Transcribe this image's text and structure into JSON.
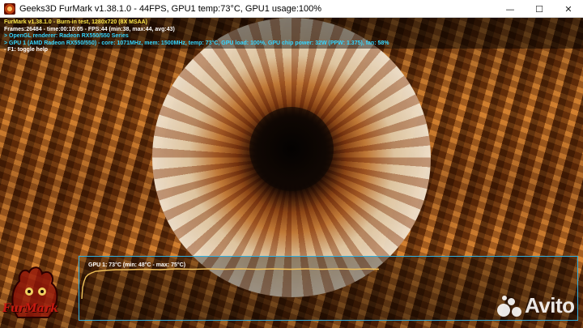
{
  "window": {
    "title": "Geeks3D FurMark v1.38.1.0 - 44FPS, GPU1 temp:73°C, GPU1 usage:100%",
    "app_icon": "furmark-app-icon",
    "controls": {
      "minimize": "—",
      "maximize": "☐",
      "close": "✕"
    }
  },
  "osd": {
    "line1": "FurMark v1.38.1.0 - Burn-in test, 1280x720 (8X MSAA)",
    "line2": "Frames:26484 - time:00:10:05 - FPS:44 (min:38, max:44, avg:43)",
    "line3": "> OpenGL renderer: Radeon RX550/550 Series",
    "line4": "> GPU 1 (AMD Radeon RX550/550) - core: 1071MHz, mem: 1500MHz, temp: 73°C, GPU load: 100%, GPU chip power: 32W (PPW: 1.375), fan: 58%",
    "line5": "- F1: toggle help",
    "colors": {
      "title": "#ffe94a",
      "stats": "#ffffff",
      "gpu": "#35d6ff"
    }
  },
  "graph": {
    "label": "GPU 1: 73°C (min: 48°C - max: 75°C)",
    "border_color": "#2fb0e0",
    "line_color": "#f2c25a"
  },
  "logo": {
    "text": "FurMark",
    "icon": "furmark-fur-logo-icon",
    "color": "#c61a10"
  },
  "watermark": {
    "text": "Avito",
    "icon": "avito-dots-icon"
  }
}
